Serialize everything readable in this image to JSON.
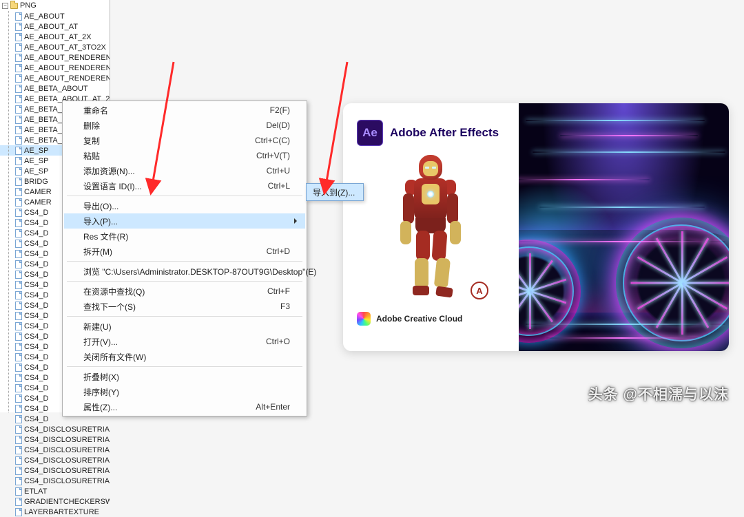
{
  "tree": {
    "root": "PNG",
    "items": [
      "AE_ABOUT",
      "AE_ABOUT_AT",
      "AE_ABOUT_AT_2X",
      "AE_ABOUT_AT_3TO2X",
      "AE_ABOUT_RENDERENG",
      "AE_ABOUT_RENDERENG",
      "AE_ABOUT_RENDERENG",
      "AE_BETA_ABOUT",
      "AE_BETA_ABOUT_AT_2",
      "AE_BETA_ABOUT_AT_3",
      "AE_BETA_SPLASH",
      "AE_BETA_SPLASH_AT_",
      "AE_BETA_SPLASH_AT_",
      "AE_SP",
      "AE_SP",
      "AE_SP",
      "BRIDG",
      "CAMER",
      "CAMER",
      "CS4_D",
      "CS4_D",
      "CS4_D",
      "CS4_D",
      "CS4_D",
      "CS4_D",
      "CS4_D",
      "CS4_D",
      "CS4_D",
      "CS4_D",
      "CS4_D",
      "CS4_D",
      "CS4_D",
      "CS4_D",
      "CS4_D",
      "CS4_D",
      "CS4_D",
      "CS4_D",
      "CS4_D",
      "CS4_D",
      "CS4_D",
      "CS4_DISCLOSURETRIA",
      "CS4_DISCLOSURETRIA",
      "CS4_DISCLOSURETRIA",
      "CS4_DISCLOSURETRIA",
      "CS4_DISCLOSURETRIA",
      "CS4_DISCLOSURETRIA",
      "ETLAT",
      "GRADIENTCHECKERSWA",
      "LAYERBARTEXTURE"
    ],
    "selected_index": 13
  },
  "context_menu": {
    "groups": [
      [
        {
          "label": "重命名",
          "shortcut": "F2(F)"
        },
        {
          "label": "删除",
          "shortcut": "Del(D)"
        },
        {
          "label": "复制",
          "shortcut": "Ctrl+C(C)"
        },
        {
          "label": "粘贴",
          "shortcut": "Ctrl+V(T)"
        },
        {
          "label": "添加资源(N)...",
          "shortcut": "Ctrl+U"
        },
        {
          "label": "设置语言 ID(I)...",
          "shortcut": "Ctrl+L"
        }
      ],
      [
        {
          "label": "导出(O)...",
          "shortcut": ""
        },
        {
          "label": "导入(P)...",
          "shortcut": "",
          "arrow": true,
          "hover": true
        },
        {
          "label": "Res 文件(R)",
          "shortcut": ""
        },
        {
          "label": "拆开(M)",
          "shortcut": "Ctrl+D"
        }
      ],
      [
        {
          "label": "浏览 \"C:\\Users\\Administrator.DESKTOP-87OUT9G\\Desktop\"(E)",
          "shortcut": ""
        }
      ],
      [
        {
          "label": "在资源中查找(Q)",
          "shortcut": "Ctrl+F"
        },
        {
          "label": "查找下一个(S)",
          "shortcut": "F3"
        }
      ],
      [
        {
          "label": "新建(U)",
          "shortcut": ""
        },
        {
          "label": "打开(V)...",
          "shortcut": "Ctrl+O"
        },
        {
          "label": "关闭所有文件(W)",
          "shortcut": ""
        }
      ],
      [
        {
          "label": "折叠树(X)",
          "shortcut": ""
        },
        {
          "label": "排序树(Y)",
          "shortcut": ""
        },
        {
          "label": "属性(Z)...",
          "shortcut": "Alt+Enter"
        }
      ]
    ]
  },
  "submenu": {
    "label": "导入到(Z)..."
  },
  "splash": {
    "product_code": "Ae",
    "product_name": "Adobe After Effects",
    "suite_name": "Adobe Creative Cloud",
    "badge_letter": "A"
  },
  "watermark": "头条 @不相濡与以沫"
}
